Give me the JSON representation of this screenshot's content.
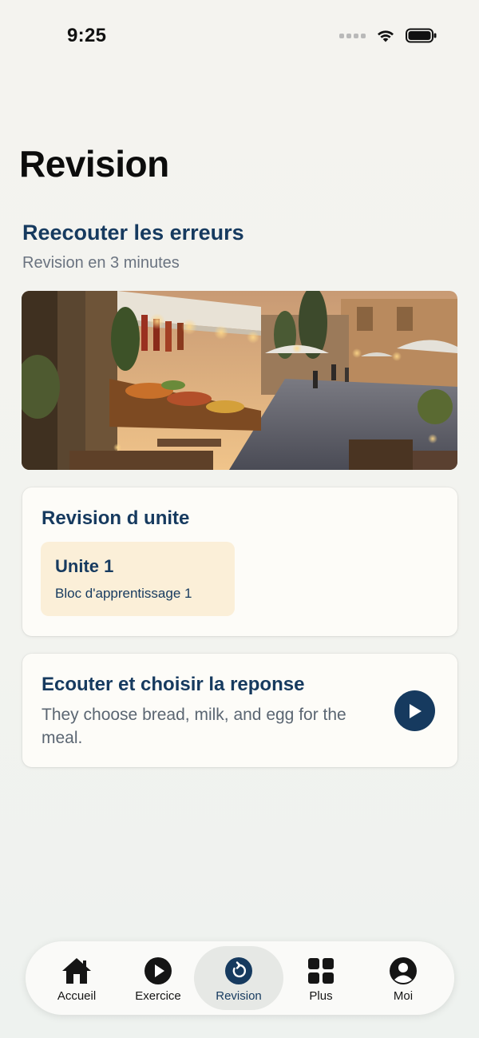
{
  "status_bar": {
    "time": "9:25",
    "icons": [
      "signal-icon",
      "wifi-icon",
      "battery-icon"
    ]
  },
  "page": {
    "title": "Revision"
  },
  "replay_section": {
    "title": "Reecouter les erreurs",
    "subtitle": "Revision en 3 minutes",
    "image": "market-street-photo"
  },
  "unit_card": {
    "title": "Revision d unite",
    "unit": {
      "title": "Unite 1",
      "subtitle": "Bloc d'apprentissage 1"
    }
  },
  "listen_card": {
    "title": "Ecouter et choisir la reponse",
    "sentence": "They choose bread, milk, and egg for the meal.",
    "icon": "play-icon"
  },
  "tabbar": {
    "active": "Revision",
    "tabs": [
      {
        "label": "Accueil",
        "icon": "home-icon"
      },
      {
        "label": "Exercice",
        "icon": "play-circle-icon"
      },
      {
        "label": "Revision",
        "icon": "revision-icon"
      },
      {
        "label": "Plus",
        "icon": "grid-icon"
      },
      {
        "label": "Moi",
        "icon": "person-icon"
      }
    ]
  },
  "colors": {
    "accent": "#163a5f",
    "chip_background": "#fbefd8",
    "card_background": "#fdfcf8",
    "page_background": "#f3f3ef"
  }
}
